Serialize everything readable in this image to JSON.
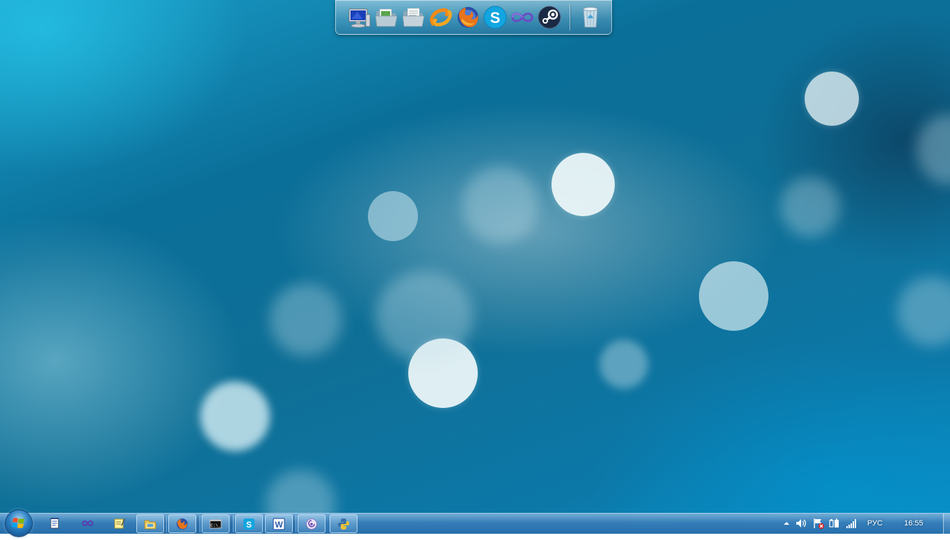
{
  "dock": {
    "items": [
      {
        "name": "computer-icon"
      },
      {
        "name": "open-folder-icon"
      },
      {
        "name": "documents-folder-icon"
      },
      {
        "name": "messenger-icon"
      },
      {
        "name": "firefox-icon"
      },
      {
        "name": "skype-icon"
      },
      {
        "name": "infinity-app-icon"
      },
      {
        "name": "steam-icon"
      },
      {
        "name": "recycle-bin-icon"
      }
    ]
  },
  "taskbar": {
    "pinned": [
      {
        "name": "notepad-icon"
      },
      {
        "name": "infinity-app-icon"
      },
      {
        "name": "sticky-notes-icon"
      },
      {
        "name": "explorer-icon"
      },
      {
        "name": "firefox-icon"
      },
      {
        "name": "command-prompt-icon"
      },
      {
        "name": "skype-icon"
      },
      {
        "name": "word-icon"
      },
      {
        "name": "torrent-icon"
      },
      {
        "name": "python-icon"
      }
    ],
    "command_prompt_glyph": "C:\\_",
    "skype_glyph": "S",
    "word_glyph": "W"
  },
  "tray": {
    "language": "РУС",
    "time": "16:55"
  },
  "colors": {
    "taskbar": "#3b7cb8",
    "firefox_orange": "#e8741c",
    "skype_blue": "#12a5e0",
    "word_blue": "#2b5aa8"
  }
}
